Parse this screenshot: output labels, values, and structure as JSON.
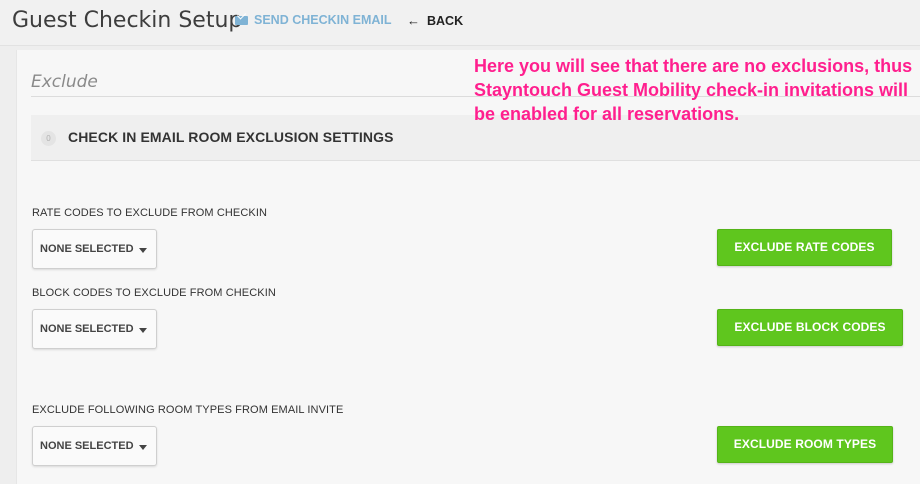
{
  "header": {
    "title": "Guest Checkin Setup",
    "send_email_label": "SEND CHECKIN EMAIL",
    "back_label": "BACK"
  },
  "section": {
    "heading": "Exclude",
    "settings_bar": {
      "badge": "0",
      "title": "CHECK IN EMAIL ROOM EXCLUSION SETTINGS"
    }
  },
  "fields": [
    {
      "label": "RATE CODES TO EXCLUDE FROM CHECKIN",
      "select_value": "NONE SELECTED",
      "button_label": "EXCLUDE RATE CODES"
    },
    {
      "label": "BLOCK CODES TO EXCLUDE FROM CHECKIN",
      "select_value": "NONE SELECTED",
      "button_label": "EXCLUDE BLOCK CODES"
    },
    {
      "label": "EXCLUDE FOLLOWING ROOM TYPES FROM EMAIL INVITE",
      "select_value": "NONE SELECTED",
      "button_label": "EXCLUDE ROOM TYPES"
    }
  ],
  "annotation": {
    "text": "Here you will see that there are no exclusions, thus Stayntouch Guest Mobility check-in invitations will be enabled for all reservations."
  },
  "colors": {
    "accent_green": "#5fc61e",
    "link_blue": "#7fb3d5",
    "annotation_pink": "#ff1f8e"
  },
  "icons": {
    "send_email": "envelope-icon",
    "back": "left-arrow-icon",
    "dropdown": "caret-down-icon"
  }
}
